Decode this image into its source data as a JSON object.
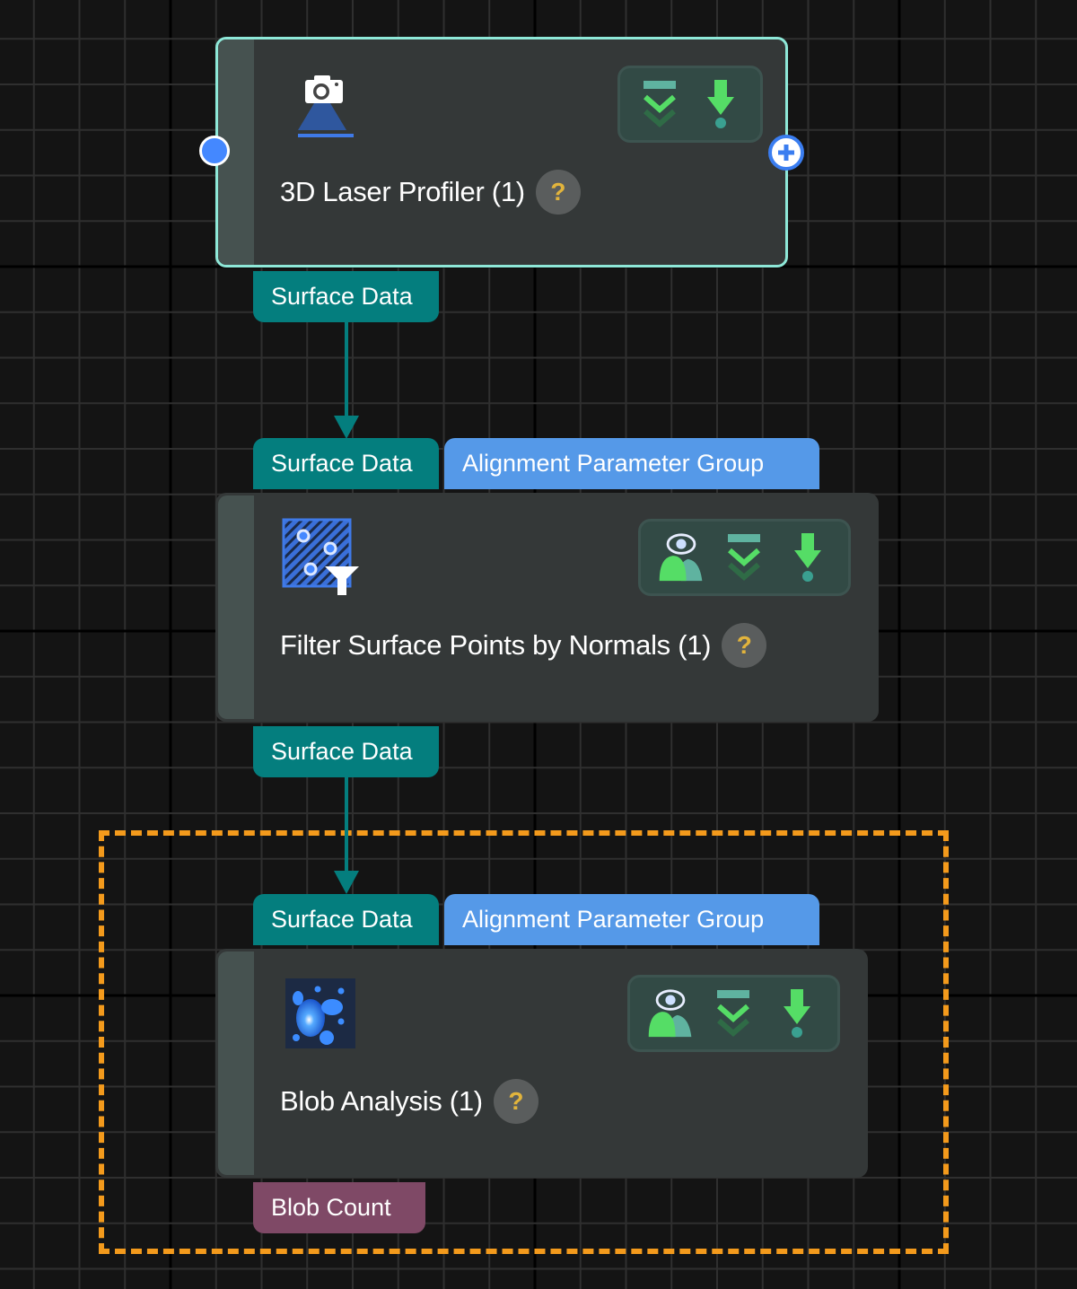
{
  "canvas": {
    "background": "#141414",
    "grid_minor_color": "#2f2f2f",
    "grid_major_color": "#000000"
  },
  "colors": {
    "selected_border": "#8ee8d8",
    "node_body": "#343838",
    "node_stripe": "#465250",
    "surface_port": "#047e7e",
    "group_port": "#5599e8",
    "result_port": "#7f4966",
    "group_box_border": "#f39a1c",
    "connector": "#047e7e",
    "action_green": "#55dd66",
    "help_question": "#e2b43c"
  },
  "nodes": [
    {
      "id": "laser-profiler",
      "title": "3D Laser Profiler (1)",
      "icon": "camera-laser-icon",
      "selected": true,
      "help": "?",
      "inputs": [],
      "outputs": [
        "Surface Data"
      ],
      "actions": [
        "data-flow-icon",
        "download-icon"
      ]
    },
    {
      "id": "filter-normals",
      "title": "Filter Surface Points by Normals (1)",
      "icon": "filter-points-icon",
      "selected": false,
      "help": "?",
      "inputs": [
        "Surface Data",
        "Alignment Parameter Group"
      ],
      "outputs": [
        "Surface Data"
      ],
      "actions": [
        "visualize-icon",
        "data-flow-icon",
        "download-icon"
      ]
    },
    {
      "id": "blob-analysis",
      "title": "Blob Analysis (1)",
      "icon": "blob-icon",
      "selected": false,
      "help": "?",
      "inputs": [
        "Surface Data",
        "Alignment Parameter Group"
      ],
      "outputs": [
        "Blob Count"
      ],
      "actions": [
        "visualize-icon",
        "data-flow-icon",
        "download-icon"
      ]
    }
  ],
  "connections": [
    {
      "from": "laser-profiler.Surface Data",
      "to": "filter-normals.Surface Data"
    },
    {
      "from": "filter-normals.Surface Data",
      "to": "blob-analysis.Surface Data"
    }
  ],
  "group_box": {
    "style": "dashed",
    "contains": [
      "blob-analysis"
    ]
  }
}
